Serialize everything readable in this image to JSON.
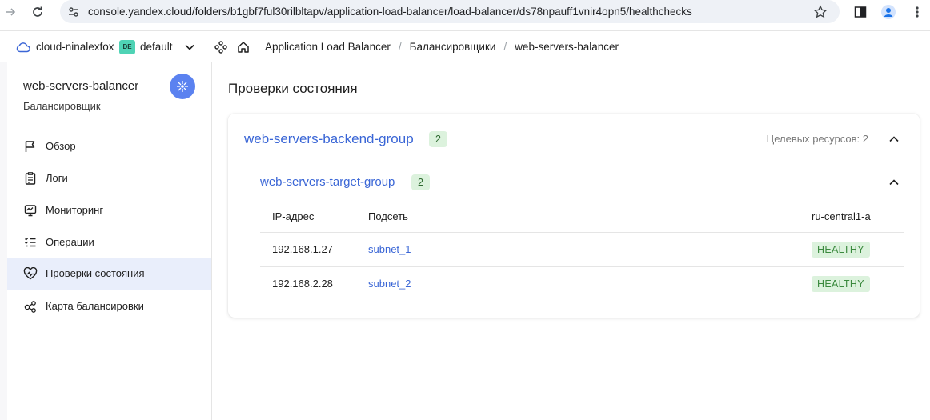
{
  "browser": {
    "url": "console.yandex.cloud/folders/b1gbf7ful30rilbltapv/application-load-balancer/load-balancer/ds78npauff1vnir4opn5/healthchecks"
  },
  "header": {
    "cloud_name": "cloud-ninalexfox",
    "folder_badge": "DE",
    "folder_name": "default",
    "breadcrumbs": [
      "Application Load Balancer",
      "Балансировщики",
      "web-servers-balancer"
    ],
    "separator": "/"
  },
  "sidebar": {
    "title": "web-servers-balancer",
    "subtitle": "Балансировщик",
    "items": [
      {
        "label": "Обзор",
        "icon": "flag-icon"
      },
      {
        "label": "Логи",
        "icon": "logs-icon"
      },
      {
        "label": "Мониторинг",
        "icon": "monitor-icon"
      },
      {
        "label": "Операции",
        "icon": "list-icon"
      },
      {
        "label": "Проверки состояния",
        "icon": "heart-pulse-icon",
        "active": true
      },
      {
        "label": "Карта балансировки",
        "icon": "nodes-icon"
      }
    ]
  },
  "main": {
    "page_title": "Проверки состояния",
    "backend_group": {
      "name": "web-servers-backend-group",
      "count": "2",
      "targets_label": "Целевых ресурсов: 2",
      "target_group": {
        "name": "web-servers-target-group",
        "count": "2",
        "columns": [
          "IP-адрес",
          "Подсеть",
          "ru-central1-a"
        ],
        "rows": [
          {
            "ip": "192.168.1.27",
            "subnet": "subnet_1",
            "status": "HEALTHY"
          },
          {
            "ip": "192.168.2.28",
            "subnet": "subnet_2",
            "status": "HEALTHY"
          }
        ]
      }
    }
  },
  "colors": {
    "accent": "#5b82f0",
    "link": "#3a66d6",
    "healthy_bg": "#dcf2dd",
    "healthy_text": "#3b8a3e",
    "active_item_bg": "#e9eefb"
  }
}
